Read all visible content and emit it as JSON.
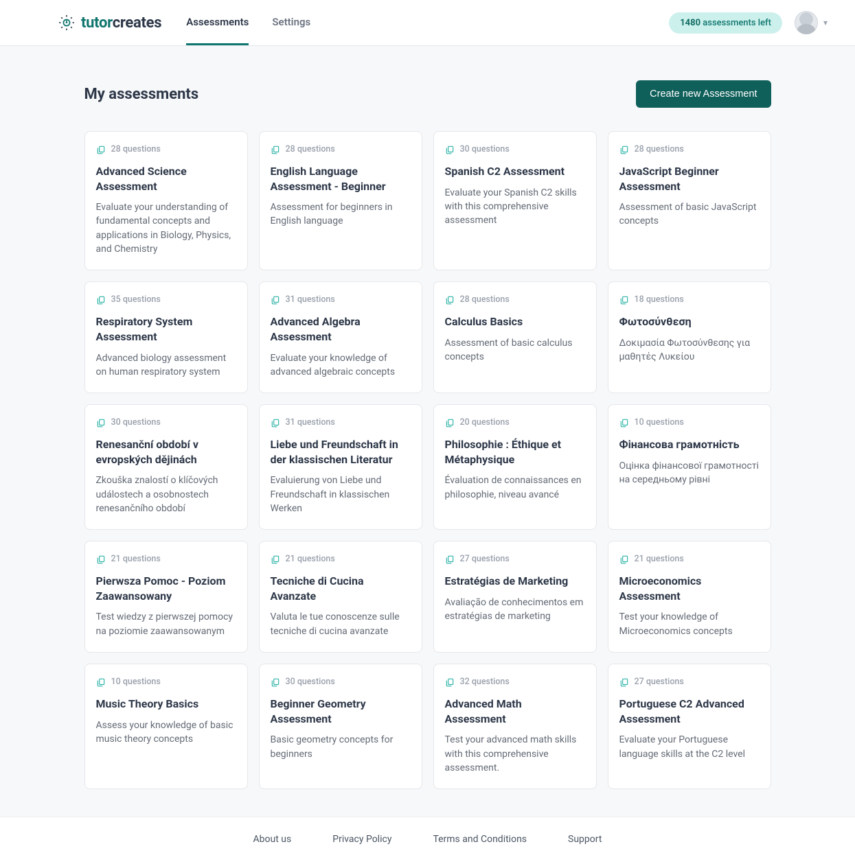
{
  "brand": {
    "name_prefix": "tutor",
    "name_suffix": "creates"
  },
  "nav": {
    "assessments": "Assessments",
    "settings": "Settings"
  },
  "credits": {
    "count": "1480",
    "label": "assessments left"
  },
  "page": {
    "title": "My assessments",
    "create_button": "Create new Assessment"
  },
  "assessments": [
    {
      "questions": "28 questions",
      "title": "Advanced Science Assessment",
      "desc": "Evaluate your understanding of fundamental concepts and applications in Biology, Physics, and Chemistry"
    },
    {
      "questions": "28 questions",
      "title": "English Language Assessment - Beginner",
      "desc": "Assessment for beginners in English language"
    },
    {
      "questions": "30 questions",
      "title": "Spanish C2 Assessment",
      "desc": "Evaluate your Spanish C2 skills with this comprehensive assessment"
    },
    {
      "questions": "28 questions",
      "title": "JavaScript Beginner Assessment",
      "desc": "Assessment of basic JavaScript concepts"
    },
    {
      "questions": "35 questions",
      "title": "Respiratory System Assessment",
      "desc": "Advanced biology assessment on human respiratory system"
    },
    {
      "questions": "31 questions",
      "title": "Advanced Algebra Assessment",
      "desc": "Evaluate your knowledge of advanced algebraic concepts"
    },
    {
      "questions": "28 questions",
      "title": "Calculus Basics",
      "desc": "Assessment of basic calculus concepts"
    },
    {
      "questions": "18 questions",
      "title": "Φωτοσύνθεση",
      "desc": "Δοκιμασία Φωτοσύνθεσης για μαθητές Λυκείου"
    },
    {
      "questions": "30 questions",
      "title": "Renesanční období v evropských dějinách",
      "desc": "Zkouška znalostí o klíčových událostech a osobnostech renesančního období"
    },
    {
      "questions": "31 questions",
      "title": "Liebe und Freundschaft in der klassischen Literatur",
      "desc": "Evaluierung von Liebe und Freundschaft in klassischen Werken"
    },
    {
      "questions": "20 questions",
      "title": "Philosophie : Éthique et Métaphysique",
      "desc": "Évaluation de connaissances en philosophie, niveau avancé"
    },
    {
      "questions": "10 questions",
      "title": "Фінансова грамотність",
      "desc": "Оцінка фінансової грамотності на середньому рівні"
    },
    {
      "questions": "21 questions",
      "title": "Pierwsza Pomoc - Poziom Zaawansowany",
      "desc": "Test wiedzy z pierwszej pomocy na poziomie zaawansowanym"
    },
    {
      "questions": "21 questions",
      "title": "Tecniche di Cucina Avanzate",
      "desc": "Valuta le tue conoscenze sulle tecniche di cucina avanzate"
    },
    {
      "questions": "27 questions",
      "title": "Estratégias de Marketing",
      "desc": "Avaliação de conhecimentos em estratégias de marketing"
    },
    {
      "questions": "21 questions",
      "title": "Microeconomics Assessment",
      "desc": "Test your knowledge of Microeconomics concepts"
    },
    {
      "questions": "10 questions",
      "title": "Music Theory Basics",
      "desc": "Assess your knowledge of basic music theory concepts"
    },
    {
      "questions": "30 questions",
      "title": "Beginner Geometry Assessment",
      "desc": "Basic geometry concepts for beginners"
    },
    {
      "questions": "32 questions",
      "title": "Advanced Math Assessment",
      "desc": "Test your advanced math skills with this comprehensive assessment."
    },
    {
      "questions": "27 questions",
      "title": "Portuguese C2 Advanced Assessment",
      "desc": "Evaluate your Portuguese language skills at the C2 level"
    }
  ],
  "footer": {
    "about": "About us",
    "privacy": "Privacy Policy",
    "terms": "Terms and Conditions",
    "support": "Support"
  }
}
